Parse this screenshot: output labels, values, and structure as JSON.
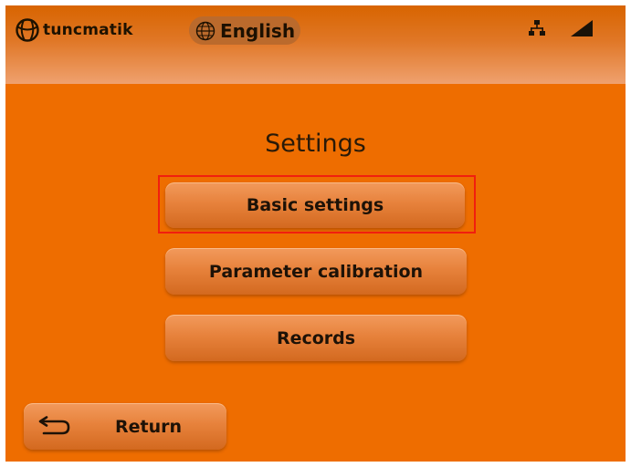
{
  "header": {
    "brand": "tuncmatik",
    "brand_icon": "tuncmatik-logo-icon",
    "language": "English",
    "language_icon": "globe-icon",
    "status_icons": [
      "network-icon",
      "signal-strength-icon"
    ]
  },
  "main": {
    "title": "Settings",
    "menu": [
      {
        "label": "Basic settings",
        "highlighted": true
      },
      {
        "label": "Parameter calibration"
      },
      {
        "label": "Records"
      }
    ]
  },
  "footer": {
    "return_label": "Return",
    "return_icon": "return-arrow-icon"
  },
  "colors": {
    "background": "#ee6d00",
    "button": "#e7823c",
    "highlight_border": "#f11f0e"
  }
}
